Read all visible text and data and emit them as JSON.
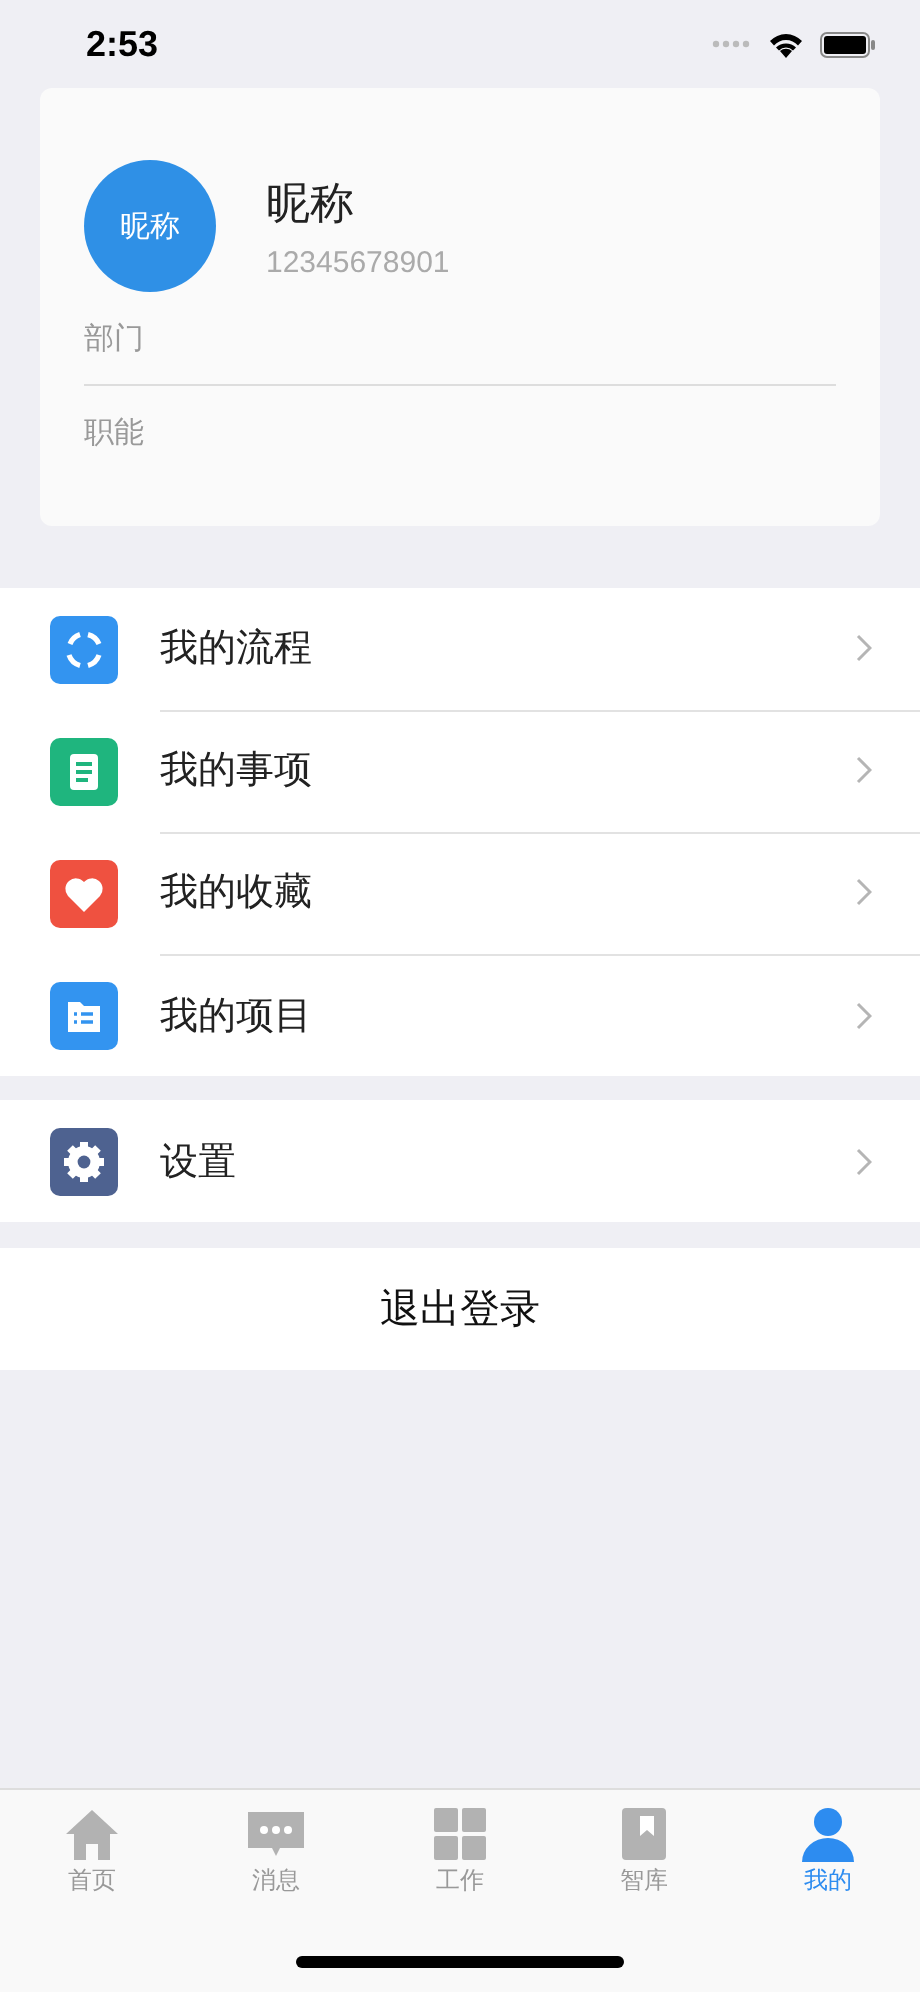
{
  "status_bar": {
    "time": "2:53"
  },
  "profile": {
    "avatar_text": "昵称",
    "name": "昵称",
    "phone": "12345678901",
    "fields": [
      "部门",
      "职能"
    ]
  },
  "menu_groups": [
    [
      {
        "kind": "flow",
        "label": "我的流程",
        "color": "#3394f0"
      },
      {
        "kind": "task",
        "label": "我的事项",
        "color": "#1fb57e"
      },
      {
        "kind": "favorite",
        "label": "我的收藏",
        "color": "#ef5140"
      },
      {
        "kind": "project",
        "label": "我的项目",
        "color": "#3394f0"
      }
    ],
    [
      {
        "kind": "settings",
        "label": "设置",
        "color": "#4e6290"
      }
    ]
  ],
  "logout": "退出登录",
  "tabs": [
    {
      "kind": "home",
      "label": "首页",
      "selected": false
    },
    {
      "kind": "message",
      "label": "消息",
      "selected": false
    },
    {
      "kind": "work",
      "label": "工作",
      "selected": false
    },
    {
      "kind": "library",
      "label": "智库",
      "selected": false
    },
    {
      "kind": "me",
      "label": "我的",
      "selected": true
    }
  ]
}
